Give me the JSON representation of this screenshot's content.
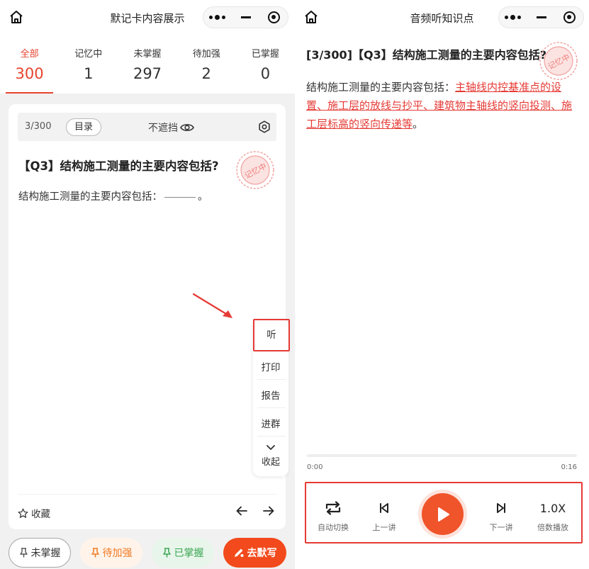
{
  "left": {
    "nav": {
      "title": "默记卡内容展示"
    },
    "stats": [
      {
        "label": "全部",
        "count": "300",
        "active": true
      },
      {
        "label": "记忆中",
        "count": "1"
      },
      {
        "label": "未掌握",
        "count": "297"
      },
      {
        "label": "待加强",
        "count": "2"
      },
      {
        "label": "已掌握",
        "count": "0"
      }
    ],
    "card": {
      "position": "3/300",
      "toc_label": "目录",
      "cover_label": "不遮挡",
      "question_title": "【Q3】结构施工测量的主要内容包括?",
      "question_body": "结构施工测量的主要内容包括：",
      "question_end": "。",
      "stamp_text": "记忆中",
      "favorite_label": "收藏"
    },
    "side_menu": {
      "listen": "听",
      "print": "打印",
      "report": "报告",
      "group": "进群",
      "fold": "收起"
    },
    "actions": {
      "unmastered": "未掌握",
      "to_strengthen": "待加强",
      "mastered": "已掌握",
      "go_recite": "去默写"
    }
  },
  "right": {
    "nav": {
      "title": "音频听知识点"
    },
    "title": "[3/300]【Q3】结构施工测量的主要内容包括?",
    "stamp_text": "记忆中",
    "body_prefix": "结构施工测量的主要内容包括：",
    "body_answer": "主轴线内控基准点的设置、施工层的放线与抄平、建筑物主轴线的竖向投测、施工层标高的竖向传递等",
    "body_suffix": "。",
    "audio": {
      "current_time": "0:00",
      "duration": "0:16",
      "progress": 0
    },
    "controls": {
      "auto_switch": "自动切换",
      "prev": "上一讲",
      "next": "下一讲",
      "rate": "1.0X",
      "rate_label": "倍数播放"
    }
  },
  "colors": {
    "accent_red": "#e53a35",
    "orange": "#f07a22",
    "green": "#3aa653",
    "play": "#f0542a"
  },
  "icons": [
    "home-icon",
    "more-icon",
    "minimize-icon",
    "record-icon",
    "eye-icon",
    "settings-icon",
    "star-icon",
    "arrow-left-icon",
    "arrow-right-icon",
    "pin-icon",
    "pen-icon",
    "repeat-icon",
    "skip-prev-icon",
    "play-icon",
    "skip-next-icon",
    "chevron-down-icon"
  ]
}
